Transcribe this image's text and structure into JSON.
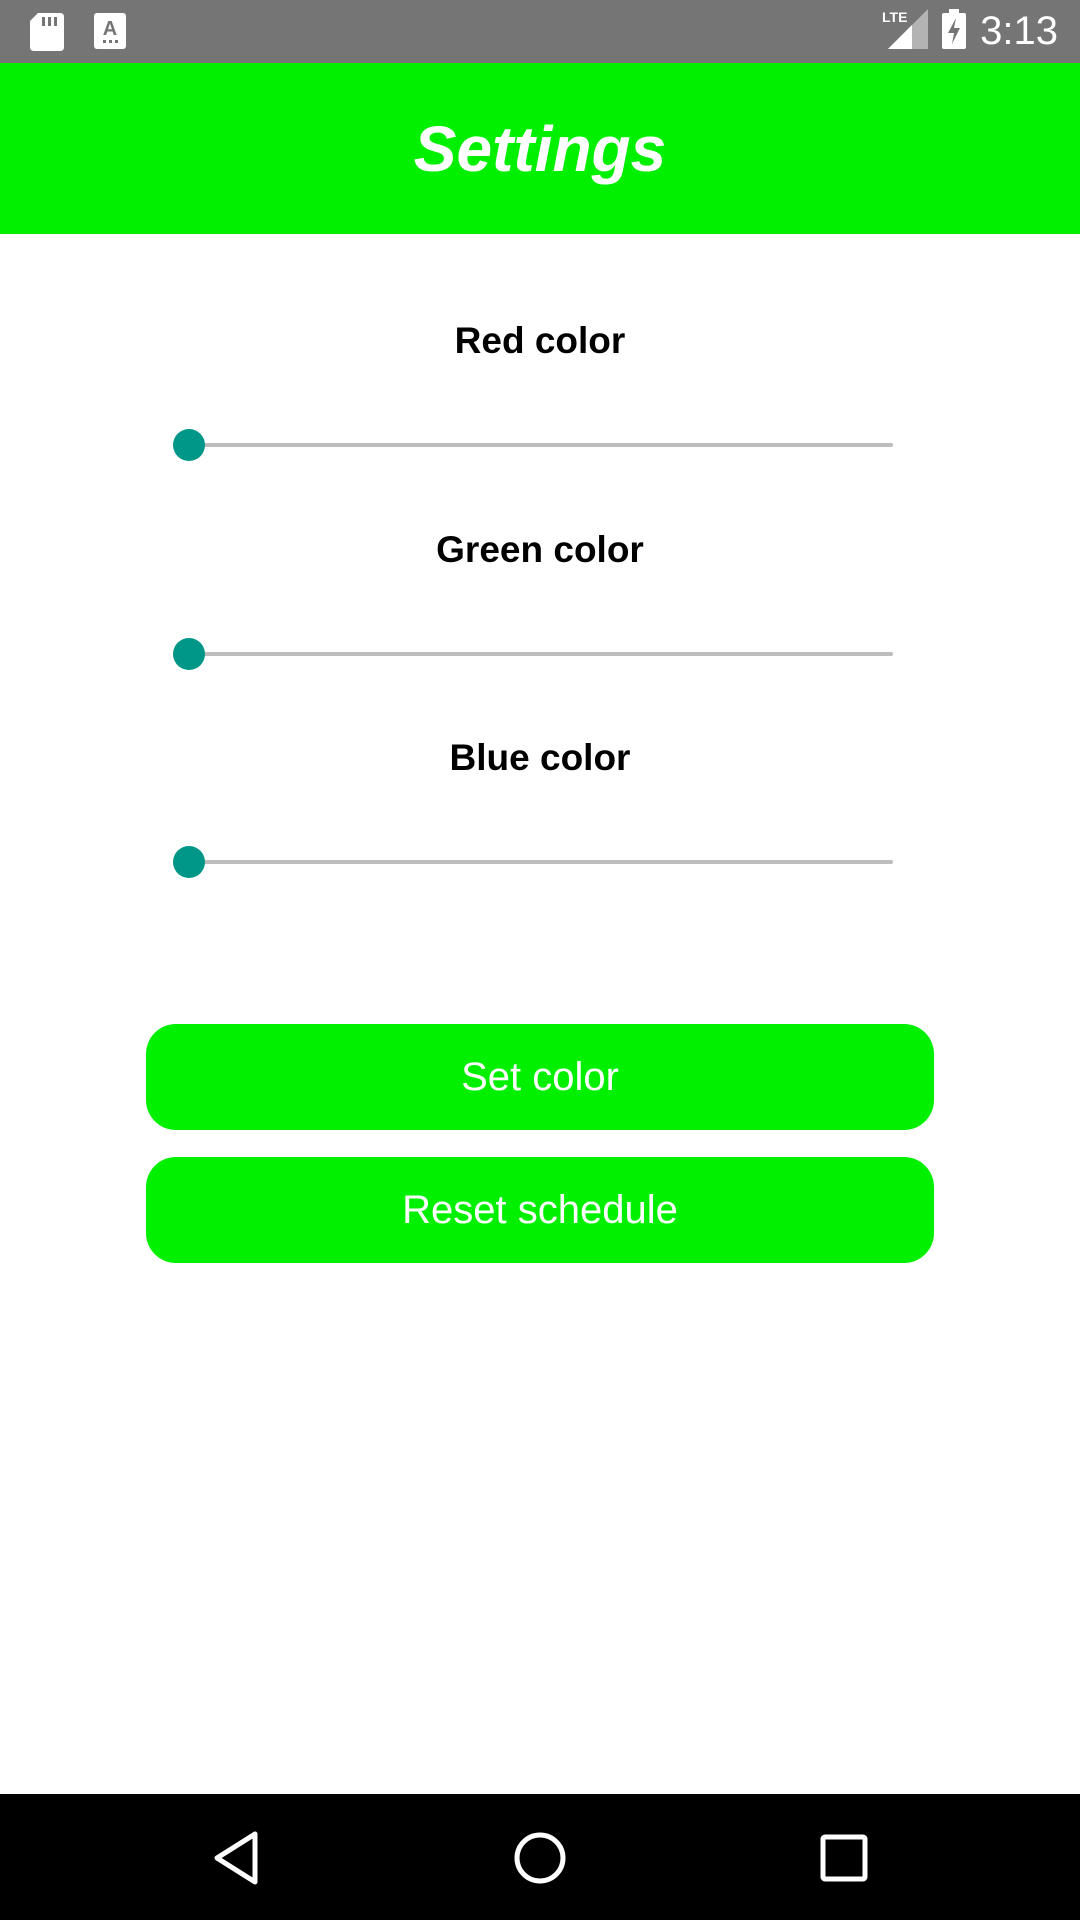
{
  "status_bar": {
    "time": "3:13",
    "network": "LTE",
    "icons": [
      "sd-card-icon",
      "text-a-icon",
      "lte-signal-icon",
      "battery-charging-icon"
    ]
  },
  "app_bar": {
    "title": "Settings",
    "background_color": "#00f000"
  },
  "sliders": [
    {
      "label": "Red color",
      "value": 0,
      "max": 255
    },
    {
      "label": "Green color",
      "value": 0,
      "max": 255
    },
    {
      "label": "Blue color",
      "value": 0,
      "max": 255
    }
  ],
  "slider_colors": {
    "thumb": "#009688",
    "track": "#bdbdbd"
  },
  "buttons": {
    "set_color": "Set color",
    "reset_schedule": "Reset schedule",
    "background_color": "#00f000"
  },
  "nav_bar": {
    "icons": [
      "back-icon",
      "home-icon",
      "recents-icon"
    ]
  }
}
